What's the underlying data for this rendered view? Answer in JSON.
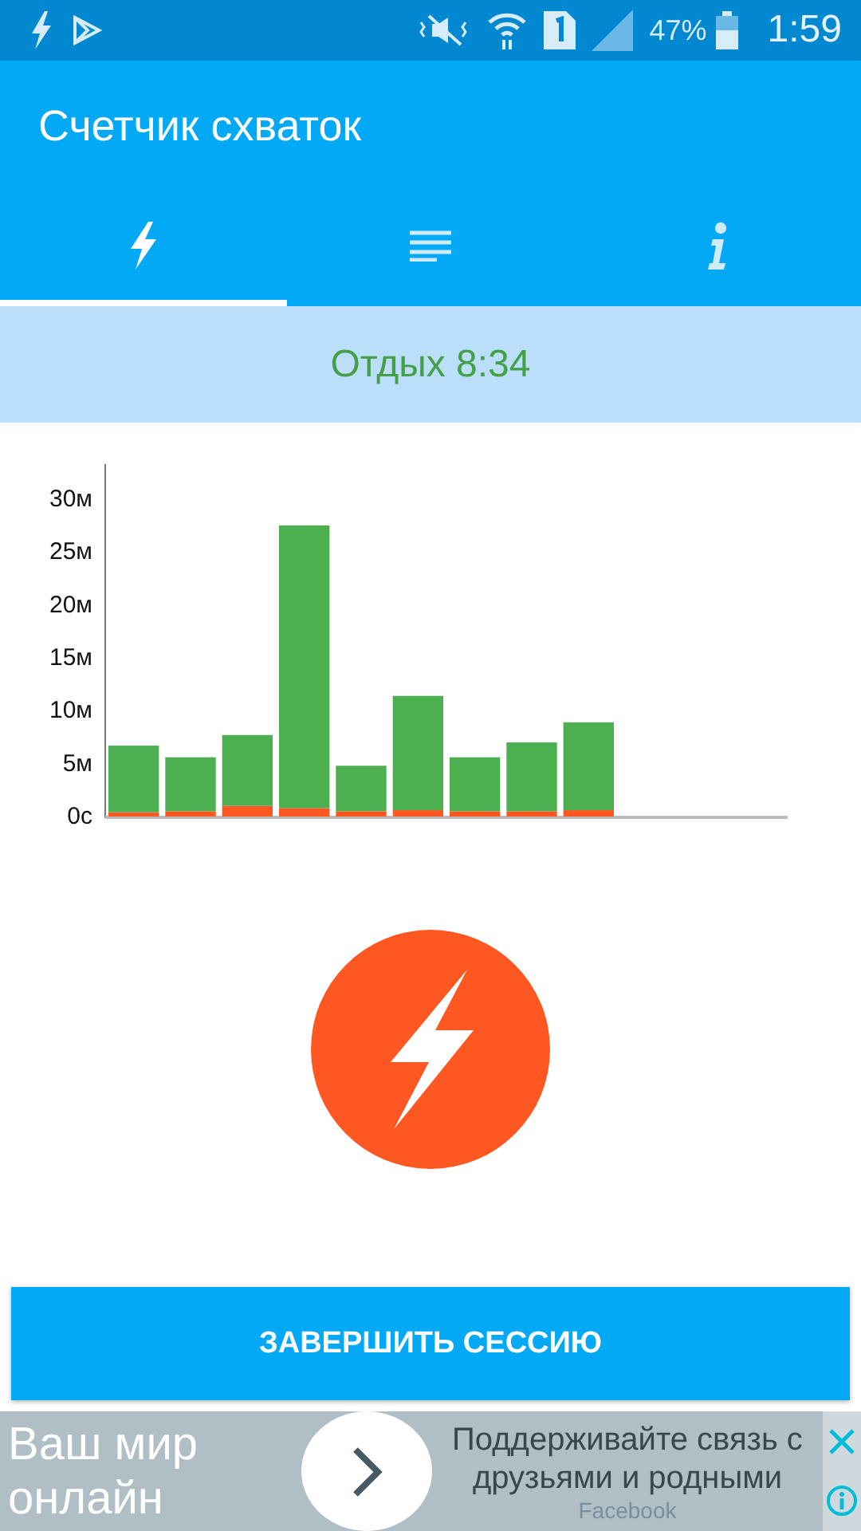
{
  "status_bar": {
    "battery": "47%",
    "time": "1:59"
  },
  "app_bar": {
    "title": "Счетчик схваток"
  },
  "tabs": [
    {
      "kind": "bolt",
      "selected": true
    },
    {
      "kind": "list",
      "selected": false
    },
    {
      "kind": "info",
      "selected": false
    }
  ],
  "rest_banner": {
    "text": "Отдых 8:34"
  },
  "chart": {
    "chart_data": {
      "type": "bar",
      "stacked": true,
      "ylim": [
        0,
        33
      ],
      "yticks": [
        {
          "value": 0,
          "label": "0с"
        },
        {
          "value": 5,
          "label": "5м"
        },
        {
          "value": 10,
          "label": "10м"
        },
        {
          "value": 15,
          "label": "15м"
        },
        {
          "value": 20,
          "label": "20м"
        },
        {
          "value": 25,
          "label": "25м"
        },
        {
          "value": 30,
          "label": "30м"
        }
      ],
      "series": [
        {
          "color": "#ff5722",
          "values": [
            0.4,
            0.5,
            1.0,
            0.8,
            0.5,
            0.6,
            0.5,
            0.5,
            0.6,
            null,
            null,
            null
          ]
        },
        {
          "color": "#4caf50",
          "values": [
            6.3,
            5.1,
            6.7,
            26.7,
            4.3,
            10.8,
            5.1,
            6.5,
            8.3,
            null,
            null,
            null
          ]
        }
      ]
    }
  },
  "end_button": {
    "label": "ЗАВЕРШИТЬ СЕССИЮ"
  },
  "ad": {
    "left_text": "Ваш мир онлайн",
    "right_text": "Поддерживайте связь с друзьями и родными",
    "source": "Facebook"
  }
}
